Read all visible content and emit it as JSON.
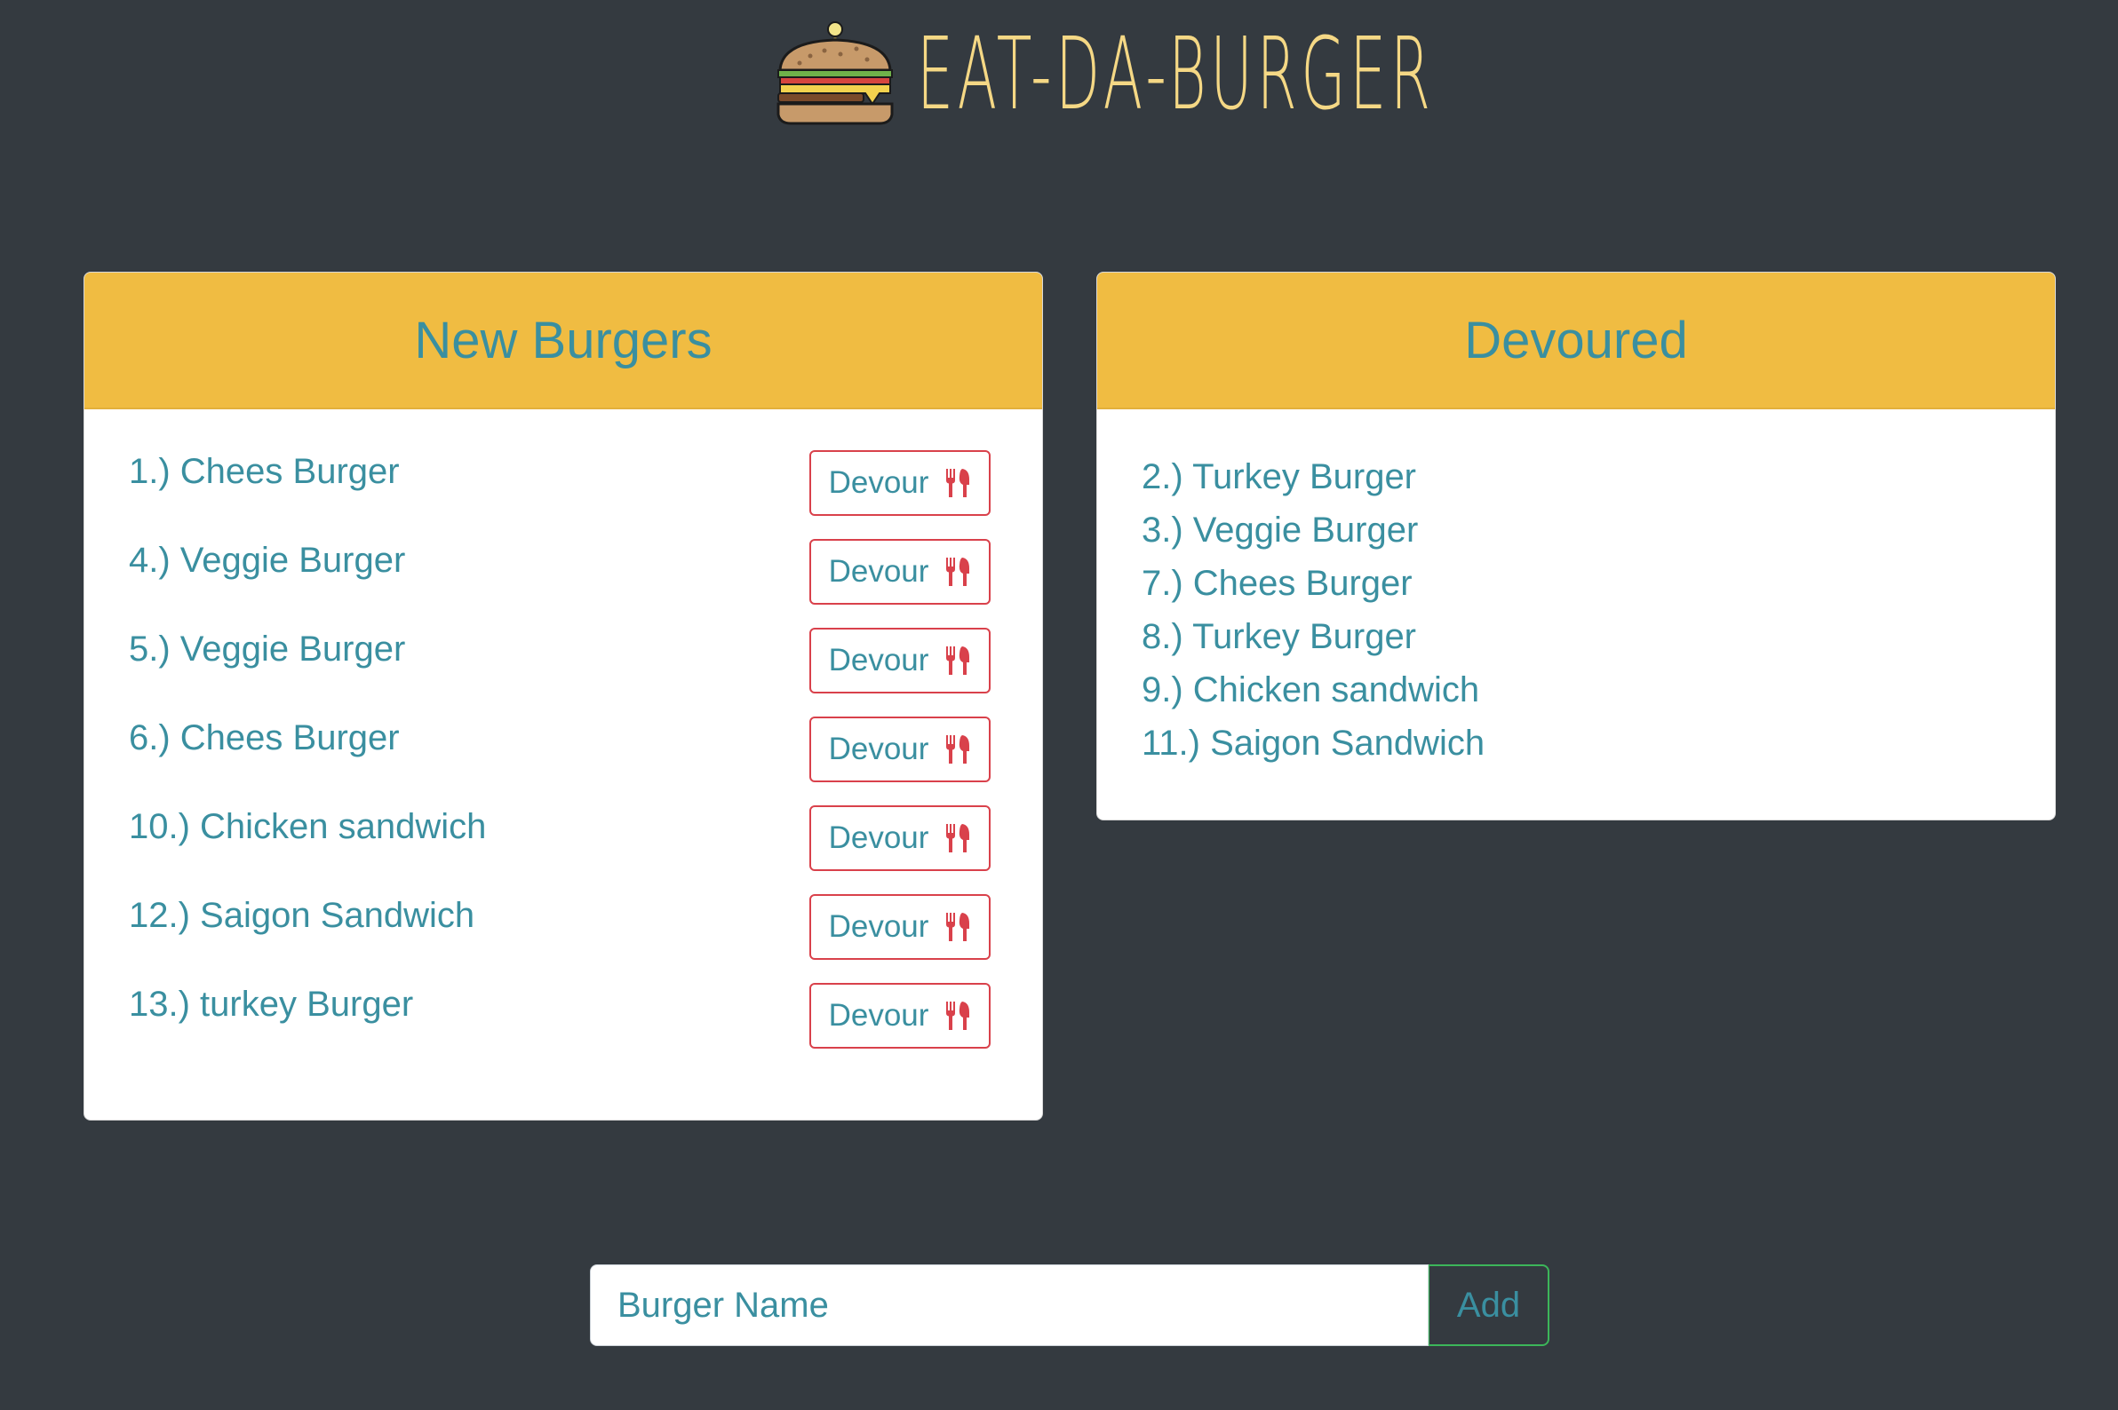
{
  "header": {
    "title": "EAT-DA-BURGER",
    "logo_icon": "burger-icon"
  },
  "new_burgers": {
    "title": "New Burgers",
    "items": [
      {
        "label": "1.) Chees Burger",
        "button": "Devour"
      },
      {
        "label": "4.) Veggie Burger",
        "button": "Devour"
      },
      {
        "label": "5.) Veggie Burger",
        "button": "Devour"
      },
      {
        "label": "6.) Chees Burger",
        "button": "Devour"
      },
      {
        "label": "10.) Chicken sandwich",
        "button": "Devour"
      },
      {
        "label": "12.) Saigon Sandwich",
        "button": "Devour"
      },
      {
        "label": "13.) turkey Burger",
        "button": "Devour"
      }
    ],
    "button_icon": "utensils-icon"
  },
  "devoured": {
    "title": "Devoured",
    "items": [
      "2.) Turkey Burger",
      "3.) Veggie Burger",
      "7.) Chees Burger",
      "8.) Turkey Burger",
      "9.) Chicken sandwich",
      "11.) Saigon Sandwich"
    ]
  },
  "form": {
    "placeholder": "Burger Name",
    "add_label": "Add"
  },
  "colors": {
    "background": "#343a40",
    "card_header": "#f0bc42",
    "text": "#3a8fa0",
    "title": "#f5d885",
    "devour_border": "#d9414b",
    "add_border": "#3cb65a"
  }
}
